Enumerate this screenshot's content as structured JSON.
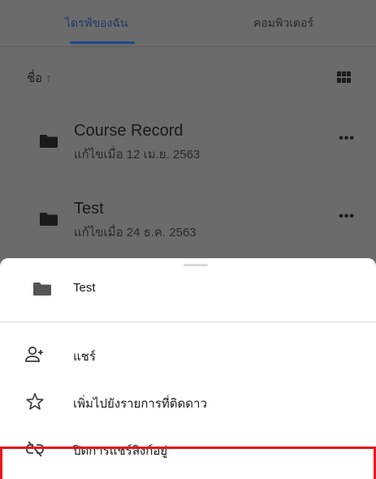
{
  "tabs": [
    {
      "label": "ไดรฟ์ของฉัน",
      "active": true
    },
    {
      "label": "คอมพิวเตอร์",
      "active": false
    }
  ],
  "sort": {
    "label": "ชื่อ",
    "arrow": "↑"
  },
  "view_toggle_icon": "grid-view-icon",
  "files": [
    {
      "name": "Course Record",
      "modified": "แก้ไขเมื่อ 12 เม.ย. 2563",
      "more": "•••"
    },
    {
      "name": "Test",
      "modified": "แก้ไขเมื่อ 24 ธ.ค. 2563",
      "more": "•••"
    }
  ],
  "sheet": {
    "title": "Test",
    "items": [
      {
        "label": "แชร์",
        "icon": "add-person-icon"
      },
      {
        "label": "เพิ่มไปยังรายการที่ติดดาว",
        "icon": "star-icon"
      },
      {
        "label": "ปิดการแชร์ลิงก์อยู่",
        "icon": "link-off-icon",
        "highlighted": true
      }
    ]
  },
  "colors": {
    "accent": "#1d4a8c",
    "highlight": "#e8141c",
    "overlay": "#6b6b6b"
  }
}
